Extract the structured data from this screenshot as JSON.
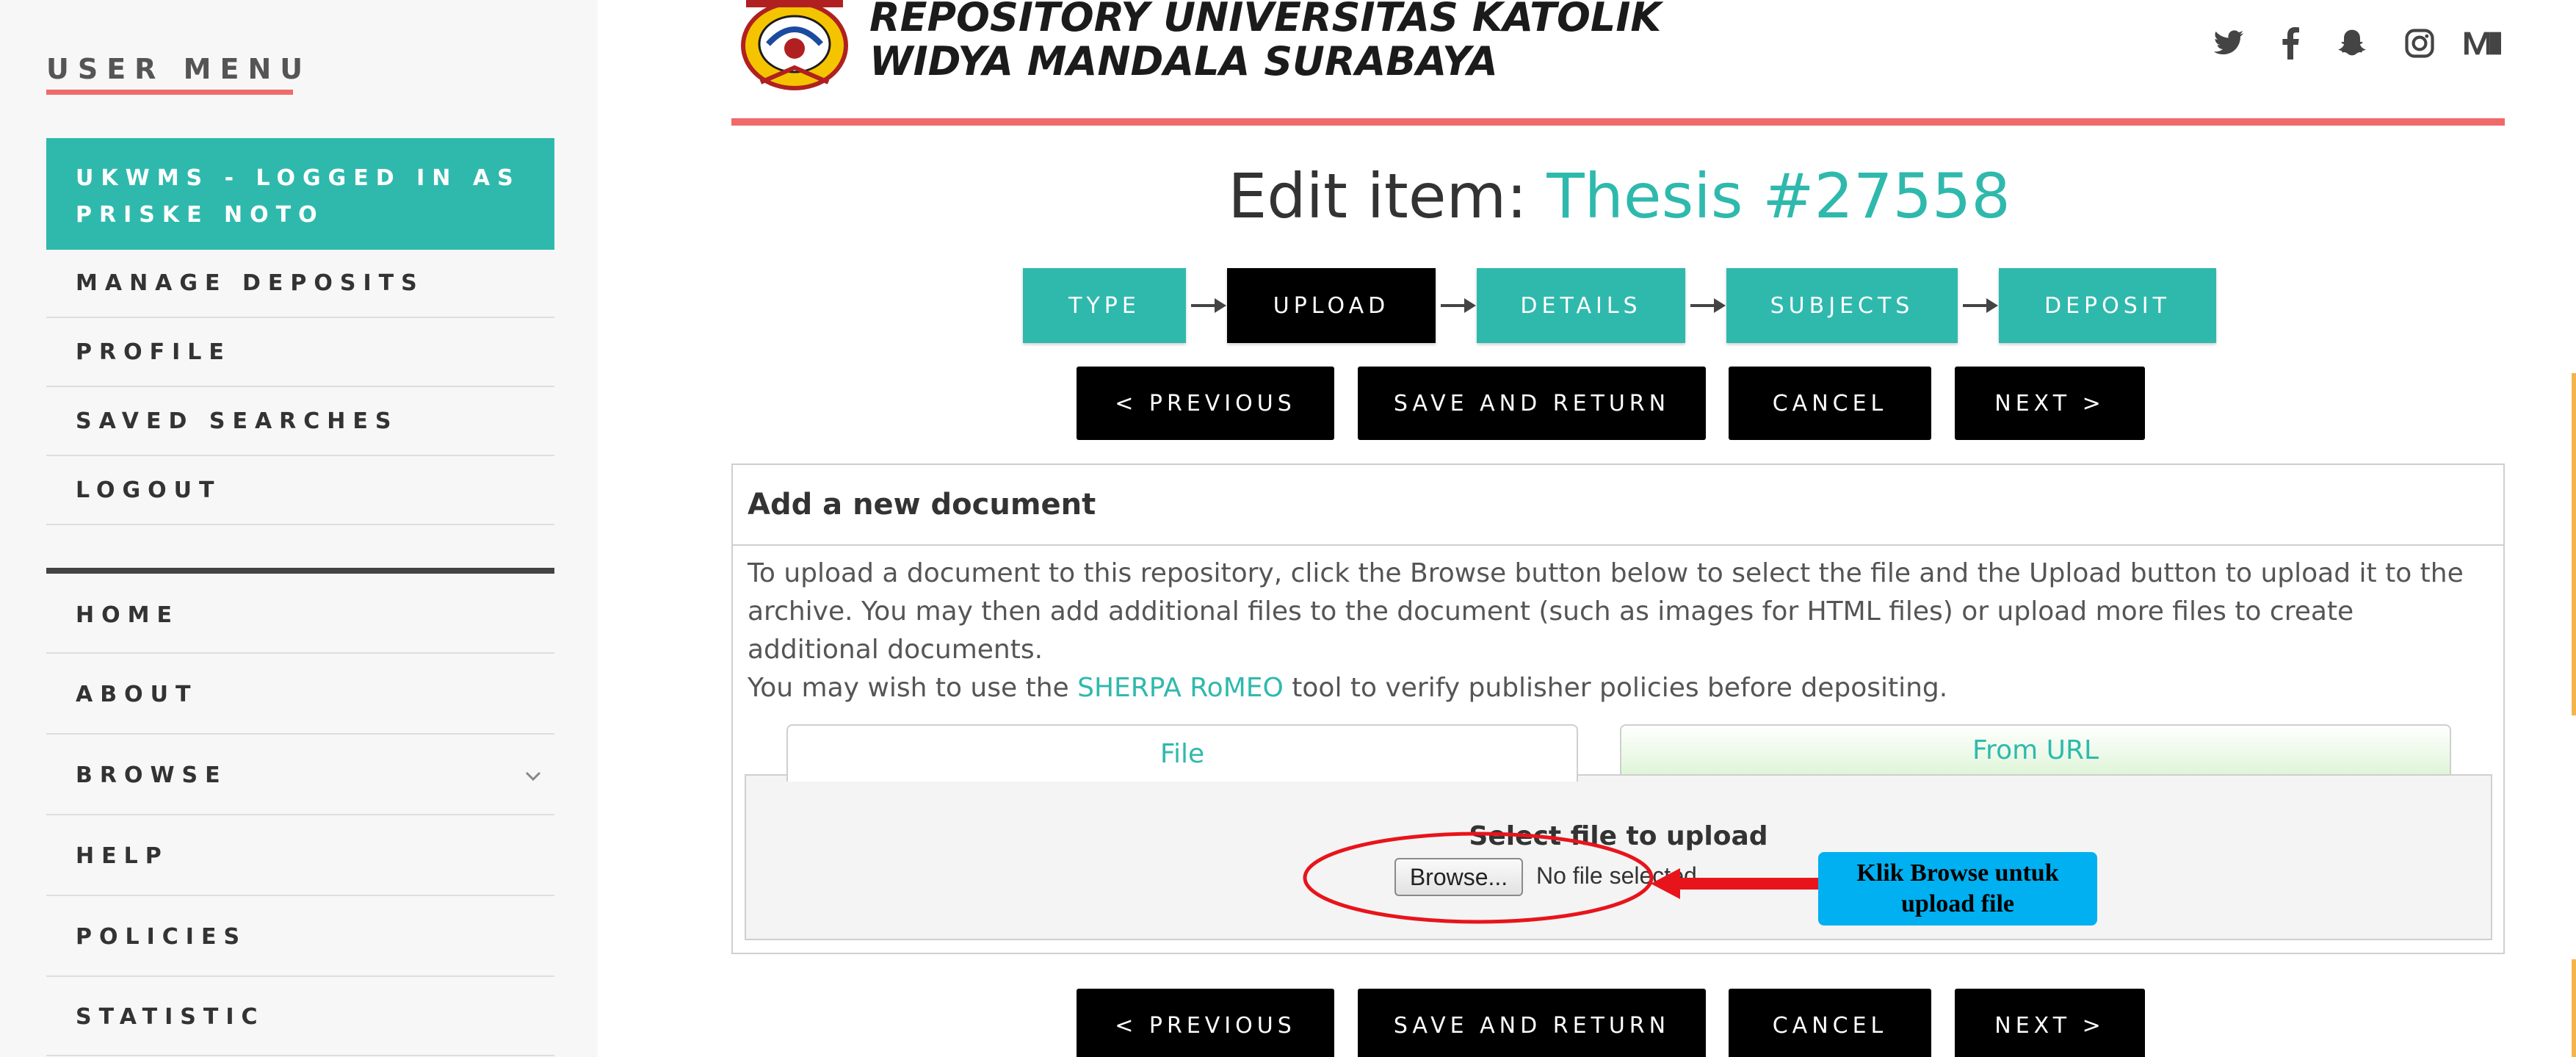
{
  "sidebar": {
    "title": "USER MENU",
    "logged_in": "UKWMS - LOGGED IN AS PRISKE NOTO",
    "user_items": [
      {
        "label": "MANAGE DEPOSITS"
      },
      {
        "label": "PROFILE"
      },
      {
        "label": "SAVED SEARCHES"
      },
      {
        "label": "LOGOUT"
      }
    ],
    "nav_items": [
      {
        "label": "HOME"
      },
      {
        "label": "ABOUT"
      },
      {
        "label": "BROWSE"
      },
      {
        "label": "HELP"
      },
      {
        "label": "POLICIES"
      },
      {
        "label": "STATISTIC"
      }
    ]
  },
  "header": {
    "title_line1": "REPOSITORY UNIVERSITAS KATOLIK",
    "title_line2": "WIDYA MANDALA SURABAYA",
    "social_icons": [
      "twitter-icon",
      "facebook-icon",
      "snapchat-icon",
      "instagram-icon",
      "medium-icon"
    ]
  },
  "page": {
    "title_prefix": "Edit item: ",
    "title_item": "Thesis #27558"
  },
  "steps": [
    {
      "label": "TYPE",
      "active": false
    },
    {
      "label": "UPLOAD",
      "active": true
    },
    {
      "label": "DETAILS",
      "active": false
    },
    {
      "label": "SUBJECTS",
      "active": false
    },
    {
      "label": "DEPOSIT",
      "active": false
    }
  ],
  "buttons": {
    "previous": "< PREVIOUS",
    "save_return": "SAVE AND RETURN",
    "cancel": "CANCEL",
    "next": "NEXT >"
  },
  "document": {
    "heading": "Add a new document",
    "paragraph1": "To upload a document to this repository, click the Browse button below to select the file and the Upload button to upload it to the archive. You may then add additional files to the document (such as images for HTML files) or upload more files to create additional documents.",
    "paragraph2_before": "You may wish to use the ",
    "paragraph2_link": "SHERPA RoMEO",
    "paragraph2_after": " tool to verify publisher policies before depositing.",
    "tab_file": "File",
    "tab_url": "From URL",
    "select_label": "Select file to upload",
    "browse_label": "Browse...",
    "no_file": "No file selected."
  },
  "annotation": {
    "text": "Klik Browse untuk upload file"
  },
  "colors": {
    "accent": "#2fb9ad",
    "brand_red": "#f06a6a",
    "annotation_blue": "#00b0f0",
    "annotation_red": "#e8141b"
  }
}
